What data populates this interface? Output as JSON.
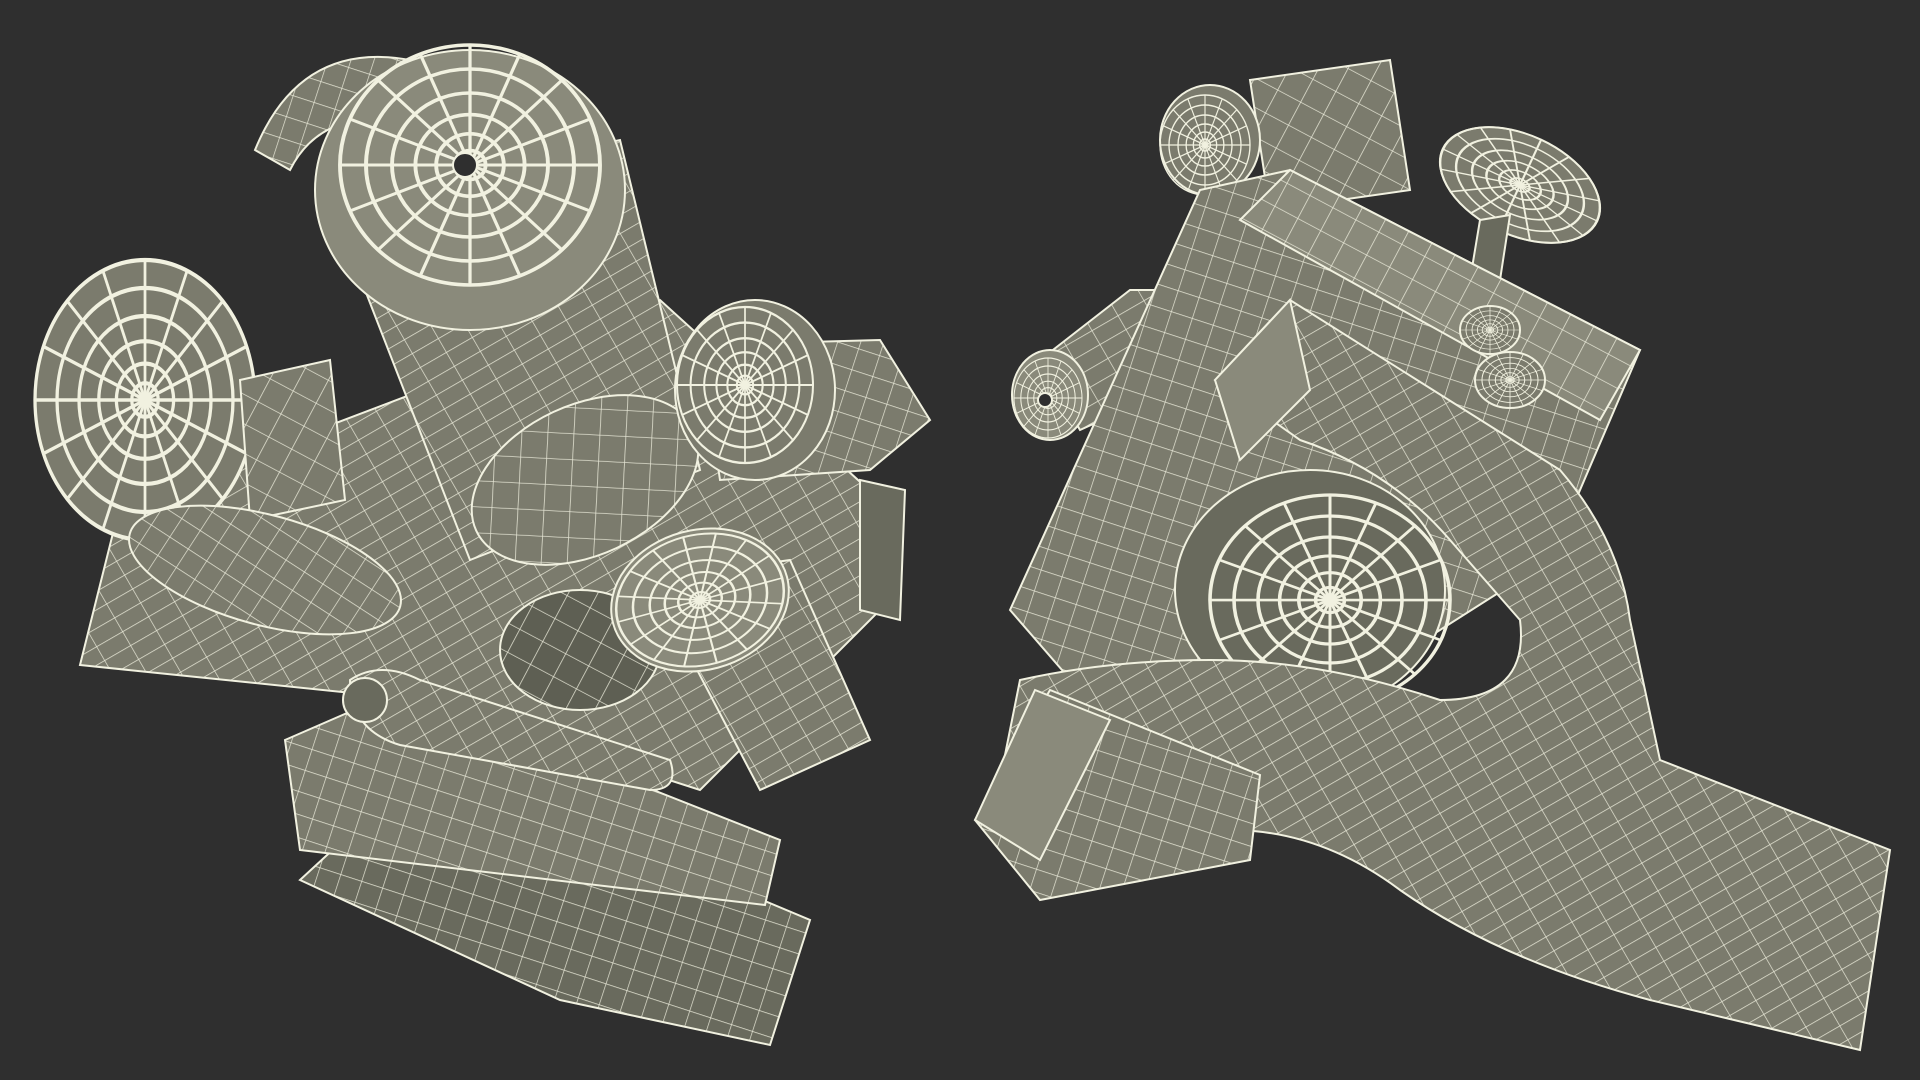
{
  "scene": {
    "background_color": "#2f2f2f",
    "surface_color": "#7b7b6d",
    "surface_shade_color": "#696a5d",
    "surface_light_color": "#8a8a7b",
    "wire_color": "#f1f1e0",
    "views": [
      {
        "view": "top"
      },
      {
        "view": "bottom"
      }
    ]
  }
}
